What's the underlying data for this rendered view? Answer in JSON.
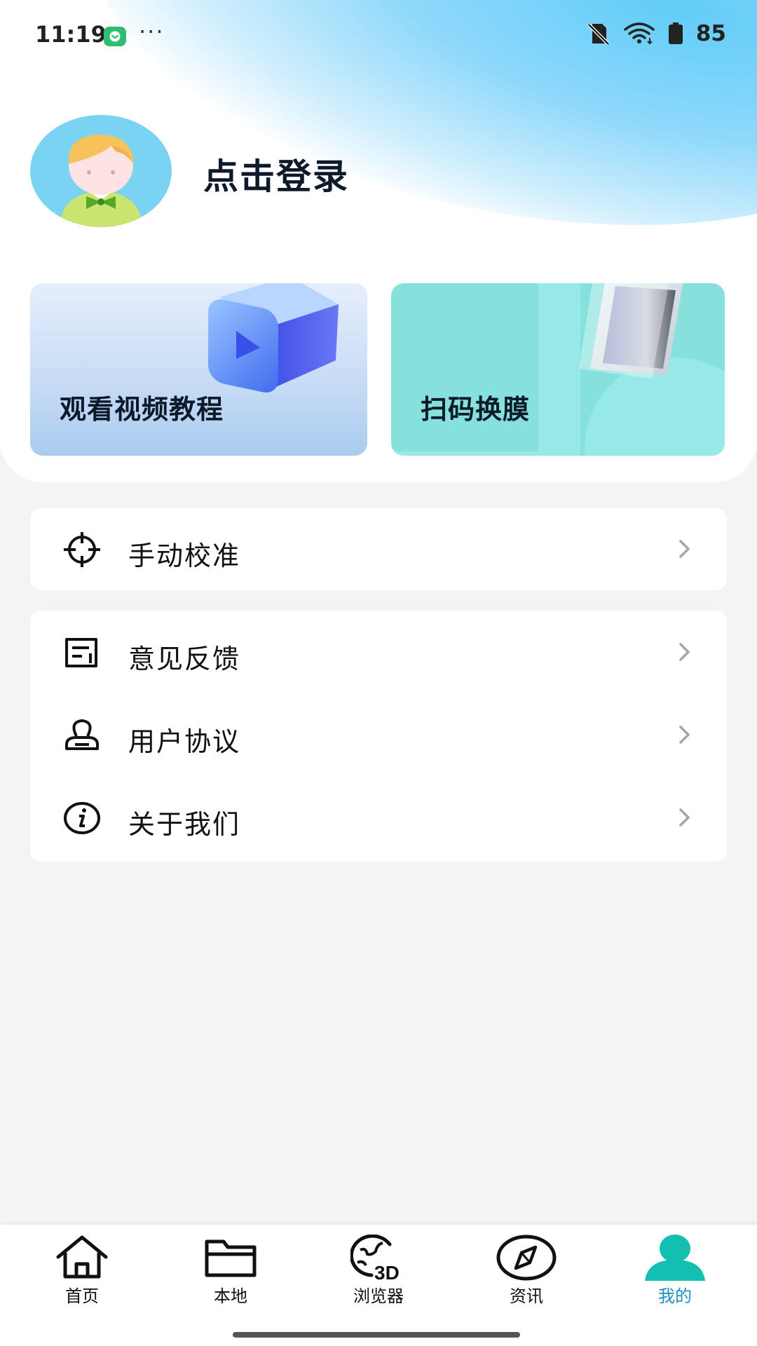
{
  "status_bar": {
    "time": "11:19",
    "more": "···",
    "battery_level": "85"
  },
  "profile": {
    "login_text": "点击登录"
  },
  "tiles": {
    "video_tutorial": "观看视频教程",
    "scan_change_film": "扫码换膜"
  },
  "menu": [
    {
      "label": "手动校准",
      "icon": "crosshair-icon"
    },
    {
      "label": "意见反馈",
      "icon": "feedback-icon"
    },
    {
      "label": "用户协议",
      "icon": "stamp-icon"
    },
    {
      "label": "关于我们",
      "icon": "info-icon"
    }
  ],
  "bottom_nav": [
    {
      "label": "首页",
      "icon": "home-icon",
      "active": false
    },
    {
      "label": "本地",
      "icon": "folder-icon",
      "active": false
    },
    {
      "label": "浏览器",
      "icon": "globe-3d-icon",
      "active": false
    },
    {
      "label": "资讯",
      "icon": "compass-icon",
      "active": false
    },
    {
      "label": "我的",
      "icon": "user-icon",
      "active": true
    }
  ],
  "colors": {
    "accent": "#13bfb0",
    "active_label": "#1a8fbf",
    "tile_scan": "#86e1dd",
    "background": "#f4f4f4"
  }
}
